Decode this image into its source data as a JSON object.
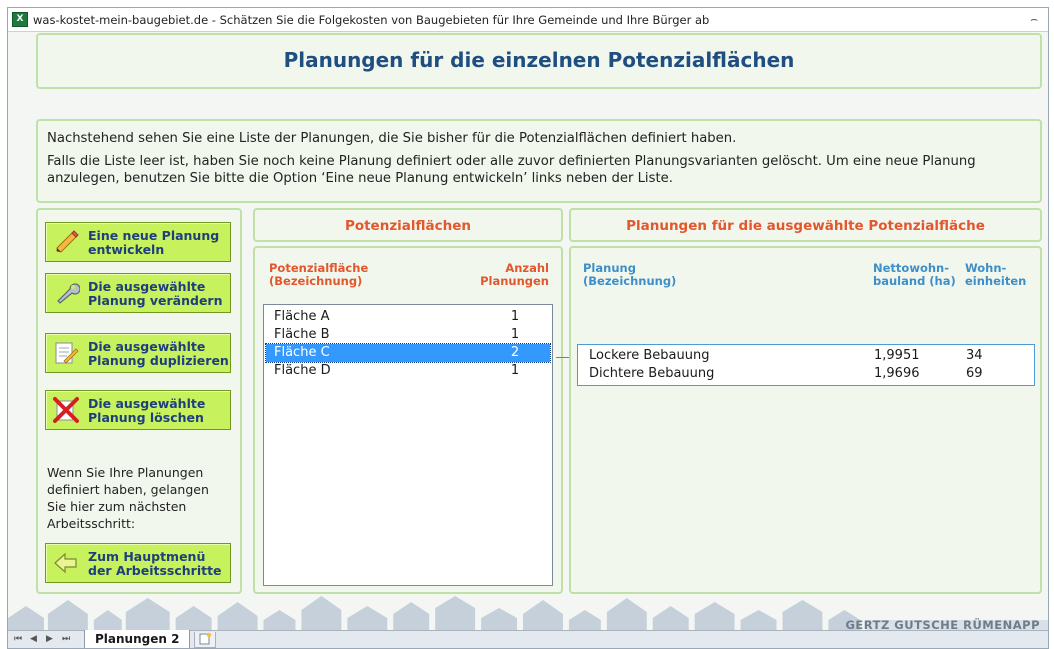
{
  "window": {
    "title": "was-kostet-mein-baugebiet.de - Schätzen Sie die Folgekosten von Baugebieten für Ihre Gemeinde und Ihre Bürger ab",
    "restore_glyph": "⌢"
  },
  "header": {
    "title": "Planungen für die einzelnen Potenzialflächen"
  },
  "intro": {
    "p1": "Nachstehend sehen Sie eine Liste der Planungen, die Sie bisher für die Potenzialflächen definiert haben.",
    "p2": "Falls die Liste leer ist, haben Sie noch keine Planung definiert oder alle zuvor definierten Planungsvarianten gelöscht. Um eine neue Planung anzulegen, benutzen Sie bitte die Option ‘Eine neue Planung entwickeln’ links neben der Liste."
  },
  "actions": {
    "new": {
      "line1": "Eine neue Planung",
      "line2": "entwickeln",
      "icon": "pencil-icon"
    },
    "edit": {
      "line1": "Die ausgewählte",
      "line2": "Planung verändern",
      "icon": "wrench-icon"
    },
    "duplicate": {
      "line1": "Die ausgewählte",
      "line2": "Planung duplizieren",
      "icon": "duplicate-icon"
    },
    "delete": {
      "line1": "Die ausgewählte",
      "line2": "Planung löschen",
      "icon": "delete-x-icon"
    },
    "info": "Wenn Sie Ihre Planungen definiert haben, gelangen Sie hier zum nächsten Arbeitsschritt:",
    "back": {
      "line1": "Zum Hauptmenü",
      "line2": "der Arbeitsschritte",
      "icon": "arrow-left-icon"
    }
  },
  "potenzialflaechen": {
    "title": "Potenzialflächen",
    "col1_line1": "Potenzialfläche",
    "col1_line2": "(Bezeichnung)",
    "col2_line1": "Anzahl",
    "col2_line2": "Planungen",
    "rows": [
      {
        "name": "Fläche A",
        "count": "1",
        "selected": false
      },
      {
        "name": "Fläche B",
        "count": "1",
        "selected": false
      },
      {
        "name": "Fläche C",
        "count": "2",
        "selected": true
      },
      {
        "name": "Fläche D",
        "count": "1",
        "selected": false
      }
    ]
  },
  "planungen": {
    "title": "Planungen für die ausgewählte Potenzialfläche",
    "col1_line1": "Planung",
    "col1_line2": "(Bezeichnung)",
    "col2_line1": "Nettowohn-",
    "col2_line2": "bauland (ha)",
    "col3_line1": "Wohn-",
    "col3_line2": "einheiten",
    "rows": [
      {
        "name": "Lockere Bebauung",
        "area": "1,9951",
        "units": "34"
      },
      {
        "name": "Dichtere Bebauung",
        "area": "1,9696",
        "units": "69"
      }
    ]
  },
  "footer": {
    "brand": "GERTZ GUTSCHE RÜMENAPP"
  },
  "tabs": {
    "nav": [
      "⏮",
      "◀",
      "▶",
      "⏭"
    ],
    "sheet": "Planungen 2"
  },
  "colors": {
    "button_fill": "#c7f25e",
    "heading_blue": "#1f4e80",
    "accent_orange": "#e2572d",
    "accent_blue": "#3e8fc8",
    "selection": "#3399ff"
  }
}
